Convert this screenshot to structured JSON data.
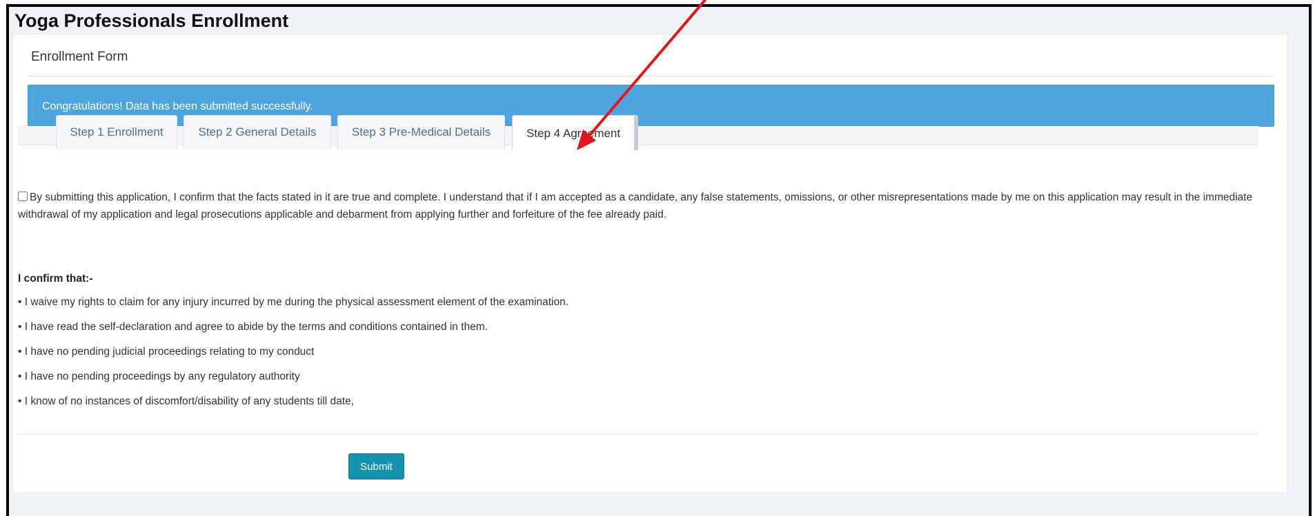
{
  "page": {
    "title": "Yoga Professionals Enrollment"
  },
  "panel": {
    "heading": "Enrollment Form"
  },
  "alert": {
    "message": "Congratulations! Data has been submitted successfully.",
    "color": "#4ea5de"
  },
  "tabs": [
    {
      "label": "Step 1 Enrollment",
      "active": false
    },
    {
      "label": "Step 2 General Details",
      "active": false
    },
    {
      "label": "Step 3 Pre-Medical Details",
      "active": false
    },
    {
      "label": "Step 4 Agreement",
      "active": true
    }
  ],
  "agreement": {
    "checked": false,
    "statement": "By submitting this application, I confirm that the facts stated in it are true and complete. I understand that if I am accepted as a candidate, any false statements, omissions, or other misrepresentations made by me on this application may result in the immediate withdrawal of my application and legal prosecutions applicable and debarment from applying further and forfeiture of the fee already paid.",
    "confirm_title": "I confirm that:-",
    "bullets": [
      "• I waive my rights to claim for any injury incurred by me during the physical assessment element of the examination.",
      "• I have read the self-declaration and agree to abide by the terms and conditions contained in them.",
      "• I have no pending judicial proceedings relating to my conduct",
      "• I have no pending proceedings by any regulatory authority",
      "• I know of no instances of discomfort/disability of any students till date,"
    ]
  },
  "actions": {
    "submit_label": "Submit",
    "submit_color": "#1393ad"
  },
  "annotation": {
    "arrow_color": "#e8141c",
    "arrow_target": "tab-step-4-agreement"
  }
}
